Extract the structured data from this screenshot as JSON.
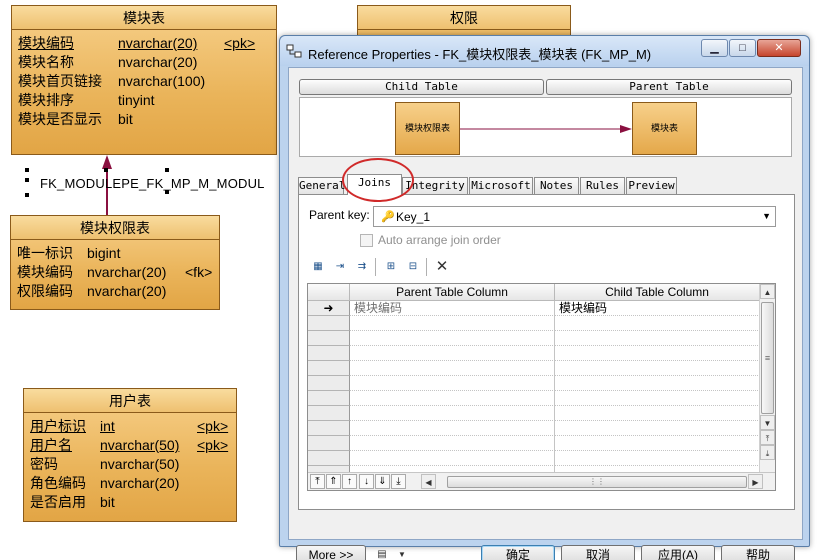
{
  "entities": {
    "module": {
      "title": "模块表",
      "rows": [
        {
          "name": "模块编码",
          "type": "nvarchar(20)",
          "key": "<pk>"
        },
        {
          "name": "模块名称",
          "type": "nvarchar(20)",
          "key": ""
        },
        {
          "name": "模块首页链接",
          "type": "nvarchar(100)",
          "key": ""
        },
        {
          "name": "模块排序",
          "type": "tinyint",
          "key": ""
        },
        {
          "name": "模块是否显示",
          "type": "bit",
          "key": ""
        }
      ]
    },
    "permission": {
      "title": "权限"
    },
    "module_permission": {
      "title": "模块权限表",
      "rows": [
        {
          "name": "唯一标识",
          "type": "bigint",
          "key": ""
        },
        {
          "name": "模块编码",
          "type": "nvarchar(20)",
          "key": "<fk>"
        },
        {
          "name": "权限编码",
          "type": "nvarchar(20)",
          "key": ""
        }
      ]
    },
    "user": {
      "title": "用户表",
      "rows": [
        {
          "name": "用户标识",
          "type": "int",
          "key": "<pk>"
        },
        {
          "name": "用户名",
          "type": "nvarchar(50)",
          "key": "<pk>"
        },
        {
          "name": "密码",
          "type": "nvarchar(50)",
          "key": ""
        },
        {
          "name": "角色编码",
          "type": "nvarchar(20)",
          "key": ""
        },
        {
          "name": "是否启用",
          "type": "bit",
          "key": ""
        }
      ]
    }
  },
  "relationship_label": "FK_MODULEPE_FK_MP_M_MODUL",
  "dialog": {
    "title": "Reference Properties - FK_模块权限表_模块表 (FK_MP_M)",
    "window_buttons": {
      "minimize": "▁",
      "maximize": "□",
      "close": "✕"
    },
    "child_table_label": "Child Table",
    "parent_table_label": "Parent Table",
    "child_table_name": "模块权限表",
    "parent_table_name": "模块表",
    "tabs": [
      "General",
      "Joins",
      "Integrity",
      "Microsoft",
      "Notes",
      "Rules",
      "Preview"
    ],
    "active_tab": "Joins",
    "parent_key_label": "Parent key:",
    "parent_key_value": "Key_1",
    "auto_arrange_label": "Auto arrange join order",
    "auto_arrange_checked": false,
    "grid": {
      "columns": [
        "Parent Table Column",
        "Child Table Column"
      ],
      "rows": [
        {
          "marker": "➜",
          "parent": "模块编码",
          "child": "模块编码"
        }
      ]
    },
    "buttons": {
      "more": "More >>",
      "ok": "确定",
      "cancel": "取消",
      "apply": "应用(A)",
      "help": "帮助"
    }
  }
}
